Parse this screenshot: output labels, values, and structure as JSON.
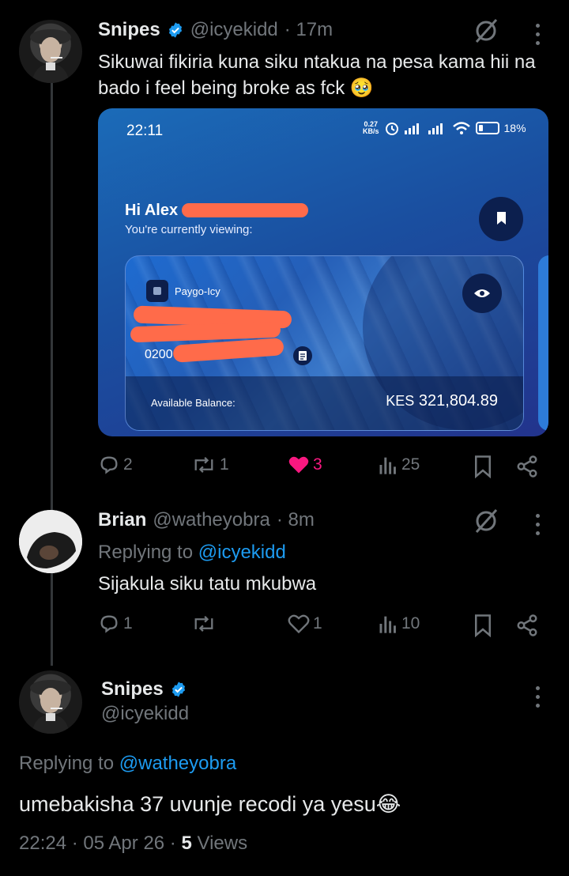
{
  "tweet1": {
    "name": "Snipes",
    "handle": "@icyekidd",
    "time": "· 17m",
    "text": "Sikuwai fikiria kuna siku ntakua na pesa kama hii na bado i feel being broke as fck",
    "emoji": "🥹",
    "actions": {
      "replies": "2",
      "retweets": "1",
      "likes": "3",
      "views": "25"
    },
    "like_color": "#f91880"
  },
  "embedded": {
    "time": "22:11",
    "speed_value": "0.27",
    "speed_unit": "KB/s",
    "battery": "18%",
    "greeting": "Hi Alex",
    "viewing": "You're currently viewing:",
    "account_name": "Paygo-Icy",
    "account_number": "0200",
    "balance_label": "Available Balance:",
    "balance_currency": "KES",
    "balance_value": "321,804.89"
  },
  "tweet2": {
    "name": "Brian",
    "handle": "@watheyobra",
    "time": "· 8m",
    "replying_prefix": "Replying to",
    "replying_to": "@icyekidd",
    "text": "Sijakula siku tatu mkubwa",
    "actions": {
      "replies": "1",
      "retweets": "",
      "likes": "1",
      "views": "10"
    }
  },
  "tweet3": {
    "name": "Snipes",
    "handle": "@icyekidd",
    "replying_prefix": "Replying to",
    "replying_to": "@watheyobra",
    "text": "umebakisha 37 uvunje recodi ya yesu",
    "emoji": "😂",
    "timestamp": "22:24 · 05 Apr 26 ·",
    "views_count": "5",
    "views_label": "Views"
  },
  "colors": {
    "accent": "#1d9bf0",
    "muted": "#71767b",
    "background": "#000000"
  }
}
